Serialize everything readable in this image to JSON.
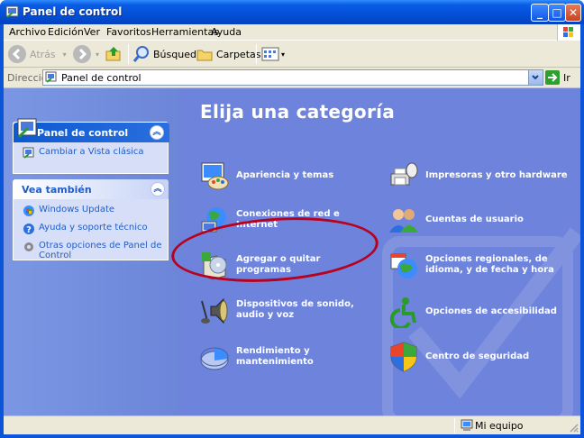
{
  "window": {
    "title": "Panel de control"
  },
  "menu": [
    "Archivo",
    "Edición",
    "Ver",
    "Favoritos",
    "Herramientas",
    "Ayuda"
  ],
  "toolbar": {
    "back": "Atrás",
    "search": "Búsqueda",
    "folders": "Carpetas"
  },
  "address": {
    "label": "Dirección",
    "value": "Panel de control",
    "go": "Ir"
  },
  "sidebar": {
    "panel1": {
      "title": "Panel de control",
      "link": "Cambiar a Vista clásica"
    },
    "panel2": {
      "title": "Vea también",
      "links": [
        "Windows Update",
        "Ayuda y soporte técnico",
        "Otras opciones de Panel de Control"
      ]
    }
  },
  "main": {
    "heading": "Elija una categoría",
    "categories": [
      {
        "label": "Apariencia y temas",
        "icon": "appearance-icon"
      },
      {
        "label": "Conexiones de red e Internet",
        "icon": "network-icon"
      },
      {
        "label": "Agregar o quitar programas",
        "icon": "add-remove-programs-icon"
      },
      {
        "label": "Dispositivos de sonido, audio y voz",
        "icon": "sound-icon"
      },
      {
        "label": "Rendimiento y mantenimiento",
        "icon": "performance-icon"
      },
      {
        "label": "Impresoras y otro hardware",
        "icon": "printer-icon"
      },
      {
        "label": "Cuentas de usuario",
        "icon": "user-accounts-icon"
      },
      {
        "label": "Opciones regionales, de idioma, y de fecha y hora",
        "icon": "regional-icon"
      },
      {
        "label": "Opciones de accesibilidad",
        "icon": "accessibility-icon"
      },
      {
        "label": "Centro de seguridad",
        "icon": "security-shield-icon"
      }
    ]
  },
  "status": {
    "location": "Mi equipo"
  },
  "colors": {
    "highlight_oval": "#b8001f",
    "content_bg": "#6e84dc",
    "title_blue": "#0450d6"
  }
}
